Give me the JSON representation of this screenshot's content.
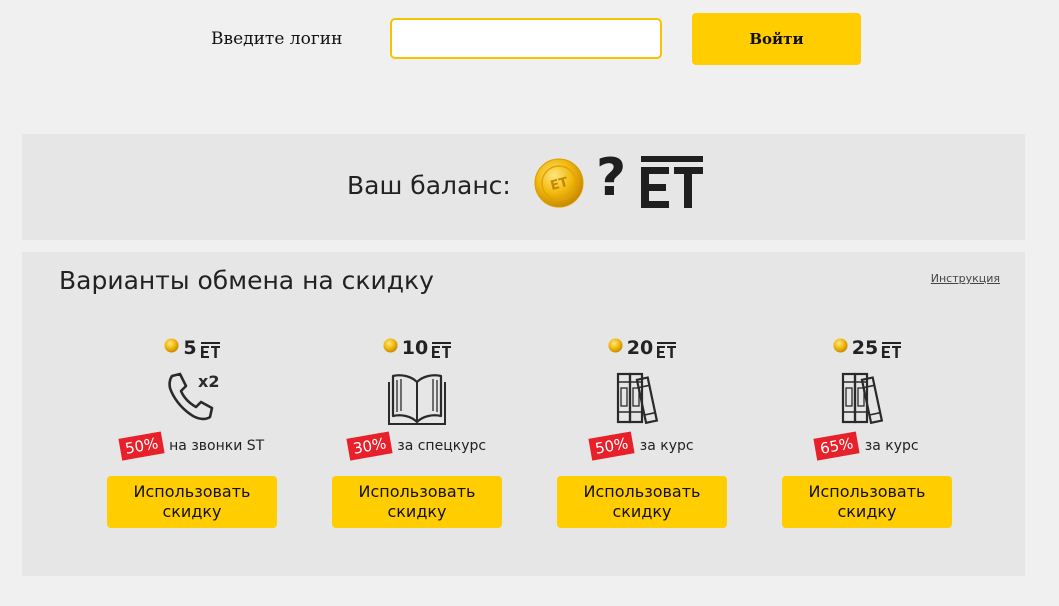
{
  "login": {
    "label": "Введите логин",
    "input_value": "",
    "input_placeholder": "",
    "submit_label": "Войти"
  },
  "balance": {
    "label": "Ваш баланс:",
    "value": "?",
    "currency": "ET"
  },
  "exchange": {
    "title": "Варианты обмена на скидку",
    "instructions_link": "Инструкция",
    "offers": [
      {
        "price": "5",
        "currency": "ET",
        "icon": "phone-x2-icon",
        "discount": "50%",
        "description": "на звонки ST",
        "button_label": "Использовать скидку"
      },
      {
        "price": "10",
        "currency": "ET",
        "icon": "open-book-icon",
        "discount": "30%",
        "description": "за спецкурс",
        "button_label": "Использовать скидку"
      },
      {
        "price": "20",
        "currency": "ET",
        "icon": "books-icon",
        "discount": "50%",
        "description": "за курс",
        "button_label": "Использовать скидку"
      },
      {
        "price": "25",
        "currency": "ET",
        "icon": "books-icon",
        "discount": "65%",
        "description": "за курс",
        "button_label": "Использовать скидку"
      }
    ]
  },
  "colors": {
    "accent_yellow": "#ffcd00",
    "badge_red": "#e8202a",
    "panel_bg": "#e6e6e6",
    "page_bg": "#f0f0f0"
  }
}
